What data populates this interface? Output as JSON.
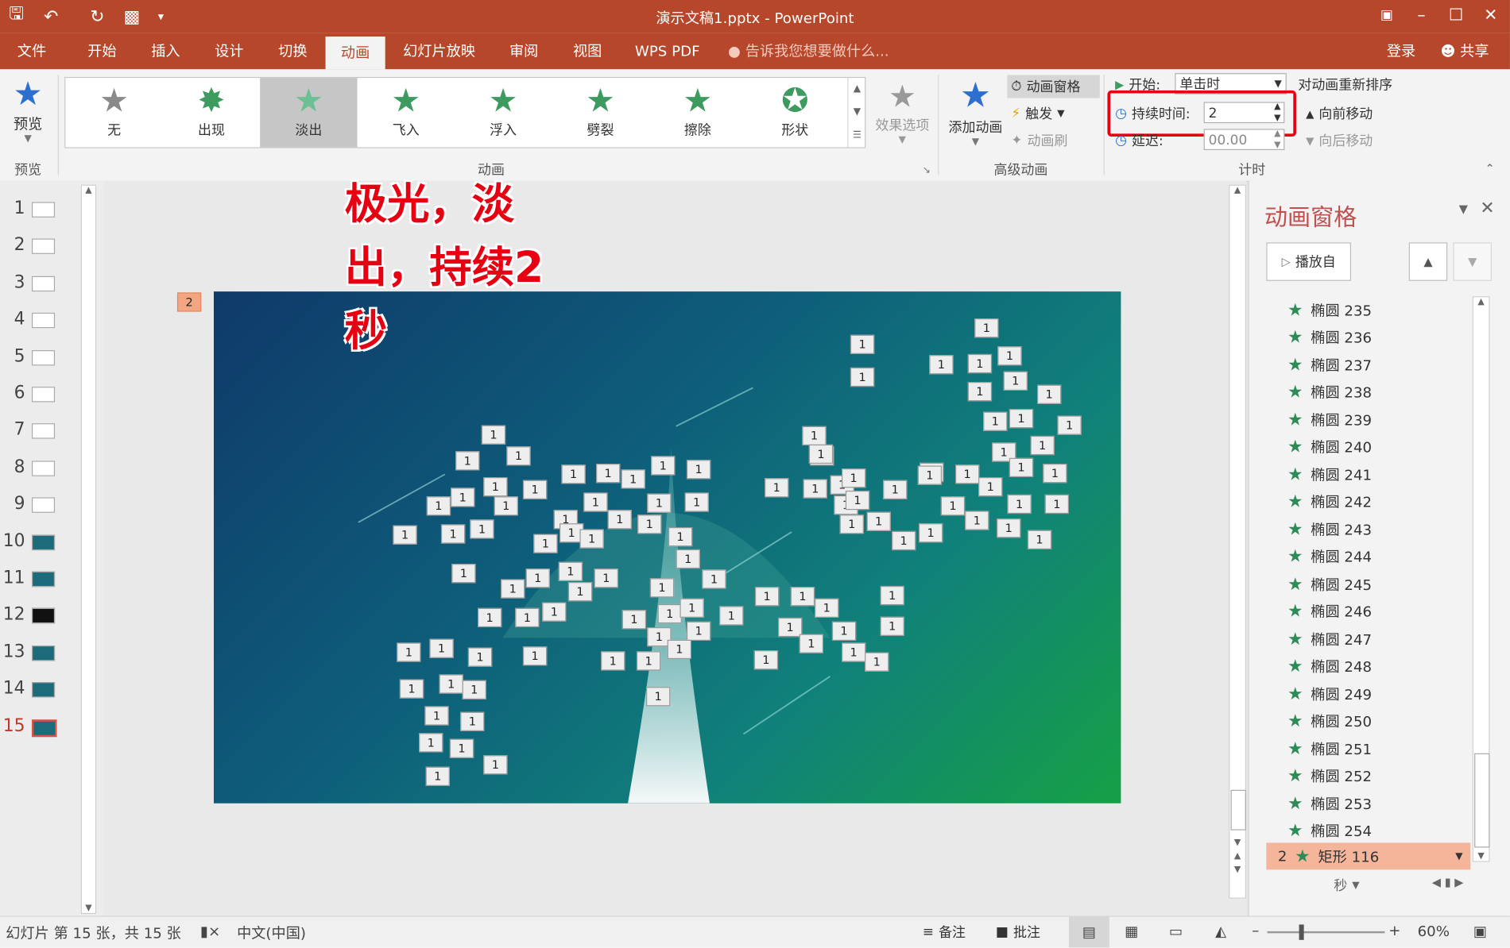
{
  "window": {
    "title": "演示文稿1.pptx - PowerPoint"
  },
  "menu_tabs": [
    {
      "label": "文件"
    },
    {
      "label": "开始"
    },
    {
      "label": "插入"
    },
    {
      "label": "设计"
    },
    {
      "label": "切换"
    },
    {
      "label": "动画"
    },
    {
      "label": "幻灯片放映"
    },
    {
      "label": "审阅"
    },
    {
      "label": "视图"
    },
    {
      "label": "WPS PDF"
    }
  ],
  "tell_me": "告诉我您想要做什么...",
  "login": "登录",
  "share": "共享",
  "ribbon": {
    "preview": {
      "label": "预览",
      "group": "预览"
    },
    "animations": [
      {
        "label": "无",
        "color": "#8a8a8a"
      },
      {
        "label": "出现",
        "color": "#3d9b5f"
      },
      {
        "label": "淡出",
        "color": "#6cc093"
      },
      {
        "label": "飞入",
        "color": "#3d9b5f"
      },
      {
        "label": "浮入",
        "color": "#3d9b5f"
      },
      {
        "label": "劈裂",
        "color": "#3d9b5f"
      },
      {
        "label": "擦除",
        "color": "#3d9b5f"
      },
      {
        "label": "形状",
        "color": "#3d9b5f"
      }
    ],
    "effect_options": "效果选项",
    "anim_group": "动画",
    "add_animation": "添加动画",
    "anim_pane_btn": "动画窗格",
    "trigger": "触发",
    "anim_painter": "动画刷",
    "advanced_group": "高级动画",
    "start_label": "开始:",
    "start_value": "单击时",
    "duration_label": "持续时间:",
    "duration_value": "2",
    "delay_label": "延迟:",
    "delay_value": "00.00",
    "reorder": "对动画重新排序",
    "move_earlier": "向前移动",
    "move_later": "向后移动",
    "timing_group": "计时"
  },
  "slides": [
    "1",
    "2",
    "3",
    "4",
    "5",
    "6",
    "7",
    "8",
    "9",
    "10",
    "11",
    "12",
    "13",
    "14",
    "15"
  ],
  "current_slide": "15",
  "slide_badge": "2",
  "annotation": {
    "line1": "极光，淡",
    "line2": "出，持续2",
    "line3": "秒"
  },
  "shape_label": "1",
  "pane": {
    "title": "动画窗格",
    "play_from": "播放自",
    "items": [
      "椭圆 235",
      "椭圆 236",
      "椭圆 237",
      "椭圆 238",
      "椭圆 239",
      "椭圆 240",
      "椭圆 241",
      "椭圆 242",
      "椭圆 243",
      "椭圆 244",
      "椭圆 245",
      "椭圆 246",
      "椭圆 247",
      "椭圆 248",
      "椭圆 249",
      "椭圆 250",
      "椭圆 251",
      "椭圆 252",
      "椭圆 253",
      "椭圆 254"
    ],
    "selected_num": "2",
    "selected_item": "矩形 116",
    "seconds": "秒"
  },
  "status": {
    "slide_info": "幻灯片 第 15 张，共 15 张",
    "language": "中文(中国)",
    "notes": "备注",
    "comments": "批注",
    "zoom": "60%",
    "zoom_level": 0.6
  }
}
